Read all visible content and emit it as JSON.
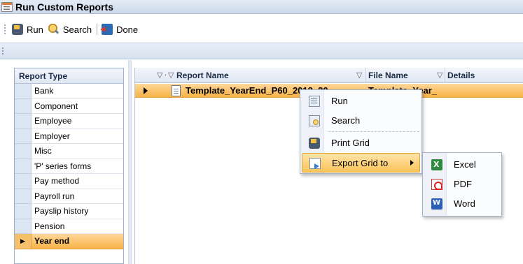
{
  "window": {
    "title": "Run Custom Reports"
  },
  "toolbar": {
    "run_label": "Run",
    "search_label": "Search",
    "done_label": "Done"
  },
  "report_type": {
    "header": "Report Type",
    "items": [
      {
        "label": "Bank"
      },
      {
        "label": "Component"
      },
      {
        "label": "Employee"
      },
      {
        "label": "Employer"
      },
      {
        "label": "Misc"
      },
      {
        "label": "'P' series forms"
      },
      {
        "label": "Pay method"
      },
      {
        "label": "Payroll run"
      },
      {
        "label": "Payslip history"
      },
      {
        "label": "Pension"
      },
      {
        "label": "Year end"
      }
    ],
    "selected": "Year end"
  },
  "grid": {
    "columns": {
      "report_name": "Report Name",
      "file_name": "File Name",
      "details": "Details"
    },
    "rows": [
      {
        "report_name": "Template_YearEnd_P60_2012_20",
        "file_name": "Template_Year_",
        "details": ""
      }
    ]
  },
  "context_menu": {
    "items": [
      {
        "label": "Run",
        "icon": "run-icon"
      },
      {
        "label": "Search",
        "icon": "search-icon"
      },
      {
        "label": "Print Grid",
        "icon": "print-icon"
      },
      {
        "label": "Export Grid to",
        "icon": "export-icon",
        "highlighted": true
      }
    ]
  },
  "export_submenu": {
    "items": [
      {
        "label": "Excel",
        "icon": "excel-icon"
      },
      {
        "label": "PDF",
        "icon": "pdf-icon"
      },
      {
        "label": "Word",
        "icon": "word-icon"
      }
    ]
  }
}
